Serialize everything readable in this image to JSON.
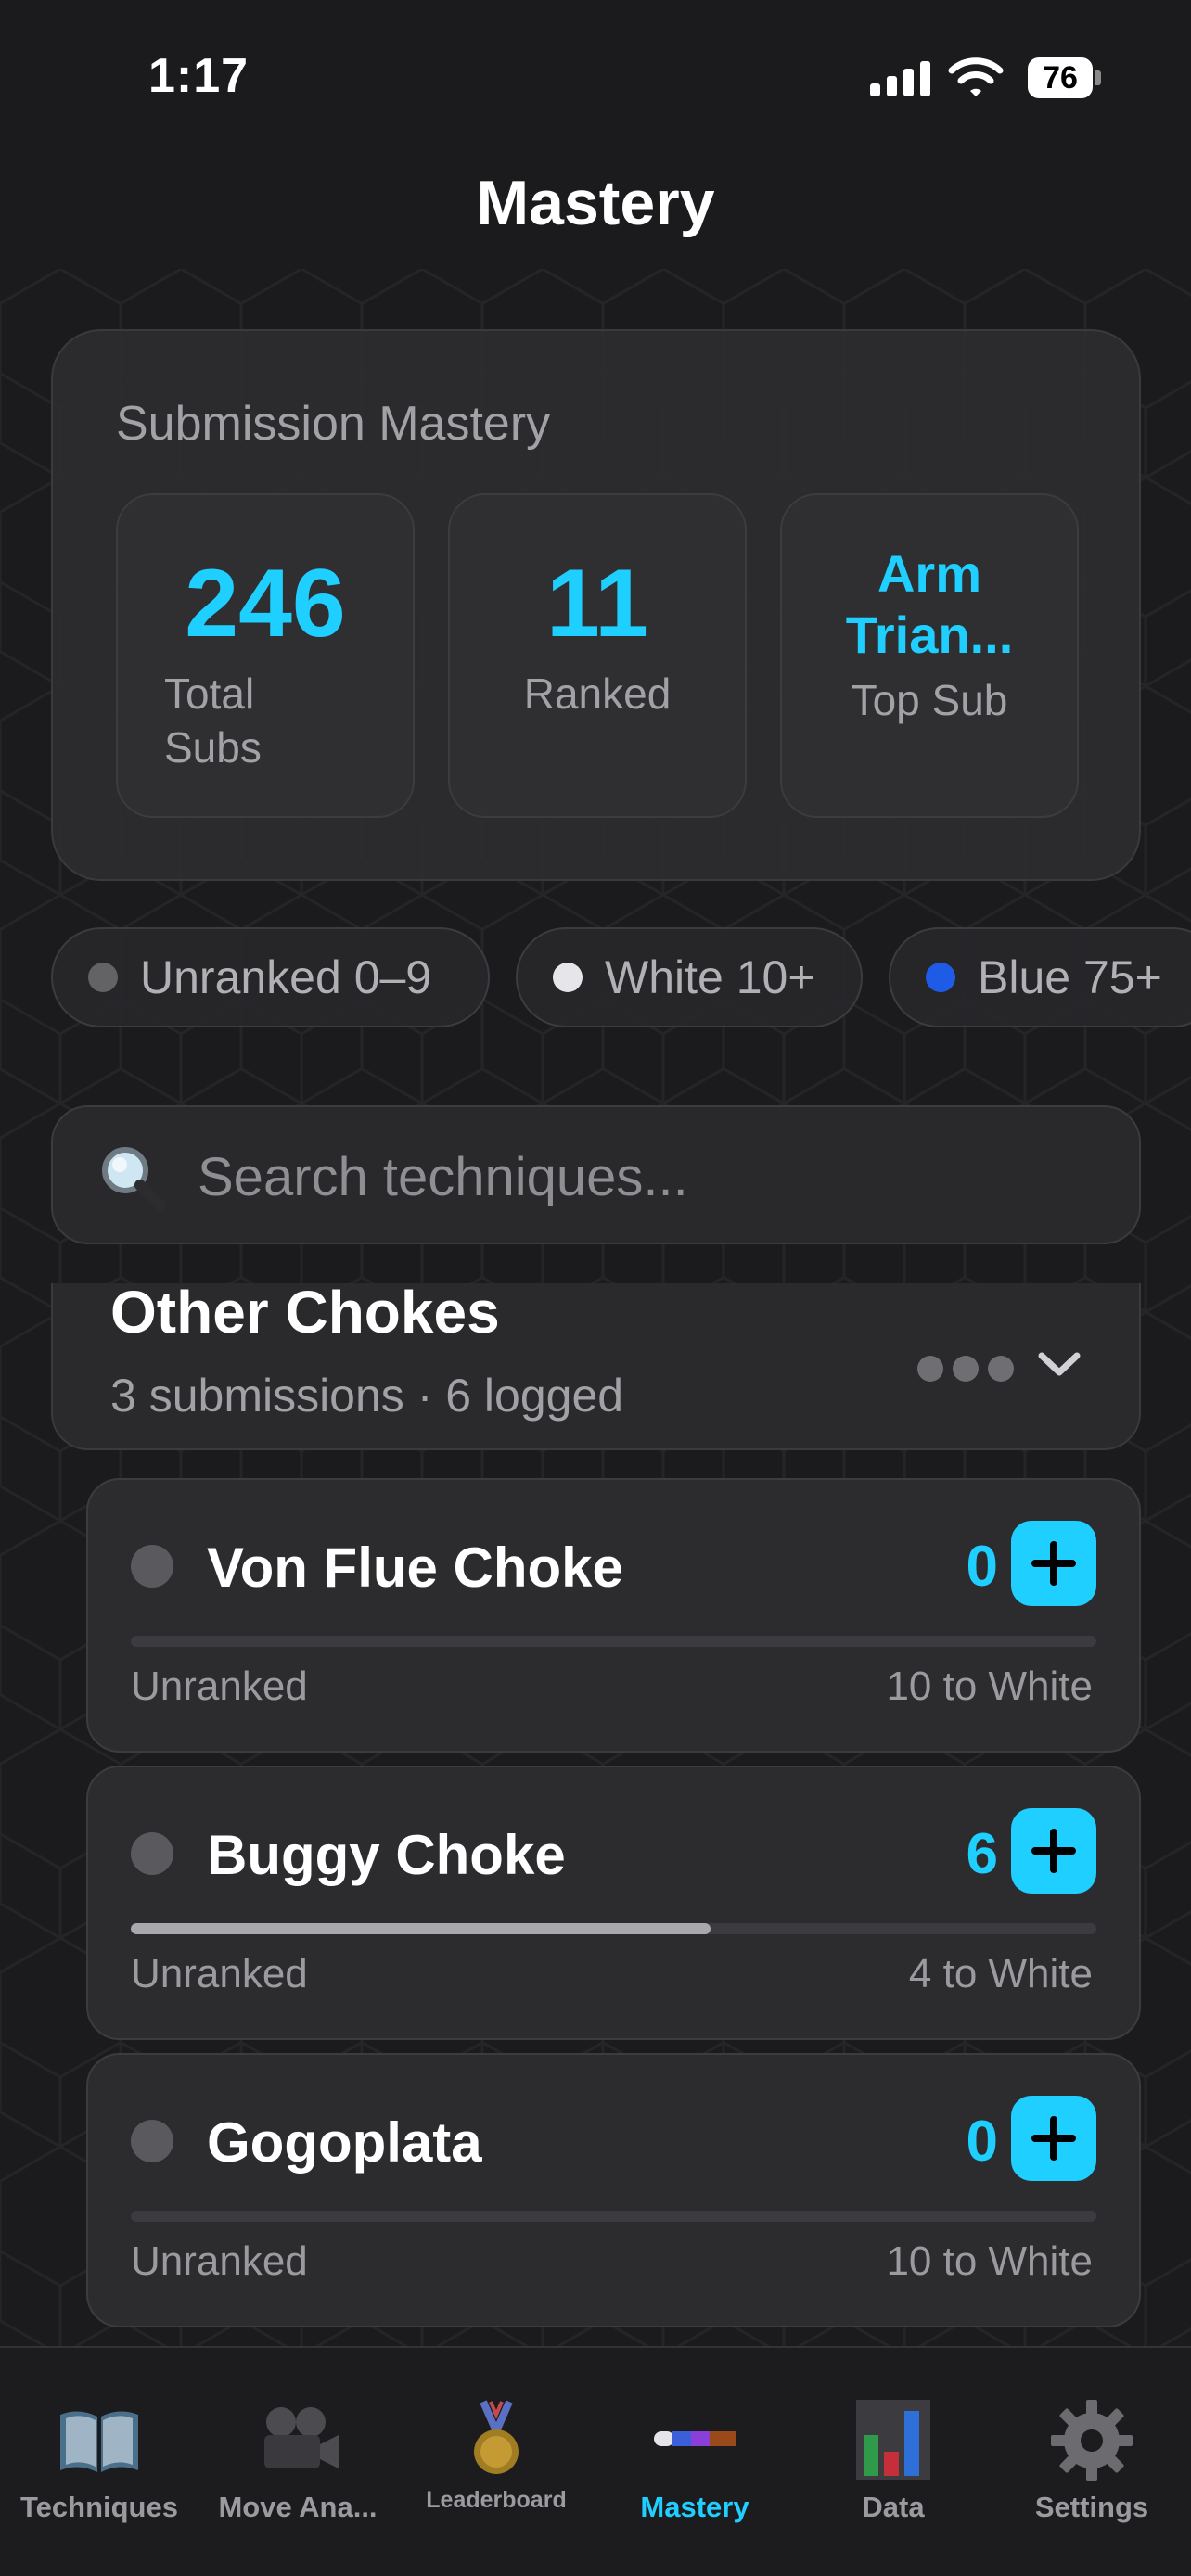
{
  "status_bar": {
    "time": "1:17",
    "battery": "76"
  },
  "header": {
    "title": "Mastery"
  },
  "summary": {
    "title": "Submission Mastery",
    "stats": [
      {
        "value": "246",
        "label_line1": "Total",
        "label_line2": "Subs"
      },
      {
        "value": "11",
        "label": "Ranked"
      },
      {
        "value_line1": "Arm",
        "value_line2": "Trian...",
        "label": "Top Sub"
      }
    ]
  },
  "rank_chips": [
    {
      "label": "Unranked 0–9",
      "color": "#636366"
    },
    {
      "label": "White 10+",
      "color": "#e5e5ea"
    },
    {
      "label": "Blue 75+",
      "color": "#1e5be6"
    }
  ],
  "search": {
    "placeholder": "Search techniques..."
  },
  "category": {
    "title": "Other Chokes",
    "meta": "3 submissions · 6 logged"
  },
  "techniques": [
    {
      "name": "Von Flue Choke",
      "count": "0",
      "rank": "Unranked",
      "next": "10 to White",
      "progress": 0.0
    },
    {
      "name": "Buggy Choke",
      "count": "6",
      "rank": "Unranked",
      "next": "4 to White",
      "progress": 0.6
    },
    {
      "name": "Gogoplata",
      "count": "0",
      "rank": "Unranked",
      "next": "10 to White",
      "progress": 0.0
    }
  ],
  "tab_bar": {
    "tabs": [
      {
        "label": "Techniques",
        "icon": "book-icon"
      },
      {
        "label": "Move Ana...",
        "icon": "film-camera-icon"
      },
      {
        "label": "Leaderboard",
        "icon": "medal-icon"
      },
      {
        "label": "Mastery",
        "icon": "belt-bars-icon",
        "active": true
      },
      {
        "label": "Data",
        "icon": "bar-chart-icon"
      },
      {
        "label": "Settings",
        "icon": "gear-icon"
      }
    ]
  },
  "colors": {
    "accent": "#1fcfff",
    "background": "#1b1b1d",
    "card": "#2c2c2f"
  }
}
